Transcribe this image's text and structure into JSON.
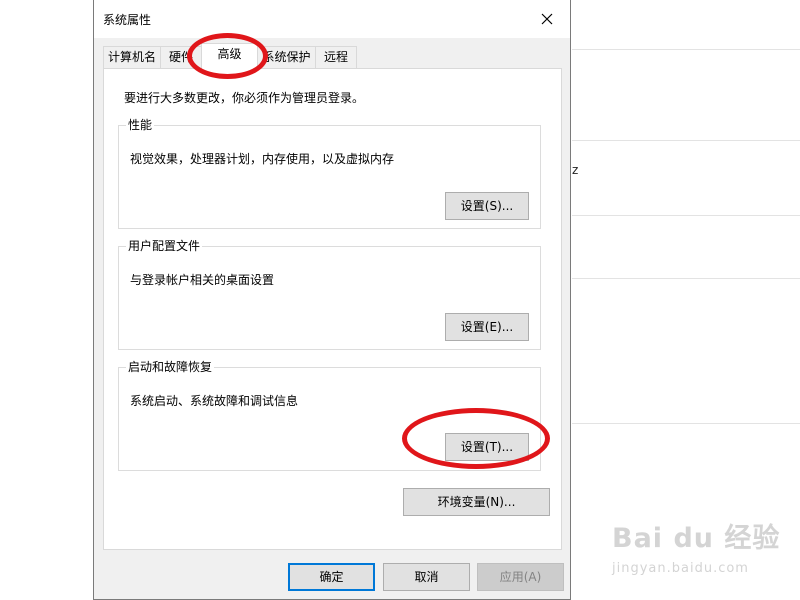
{
  "background": {
    "frag1": "z"
  },
  "dialog": {
    "title": "系统属性",
    "tabs": [
      {
        "label": "计算机名"
      },
      {
        "label": "硬件"
      },
      {
        "label": "高级"
      },
      {
        "label": "系统保护"
      },
      {
        "label": "远程"
      }
    ],
    "active_tab": "高级",
    "notice": "要进行大多数更改，你必须作为管理员登录。",
    "groups": {
      "performance": {
        "legend": "性能",
        "desc": "视觉效果，处理器计划，内存使用，以及虚拟内存",
        "button": "设置(S)..."
      },
      "profiles": {
        "legend": "用户配置文件",
        "desc": "与登录帐户相关的桌面设置",
        "button": "设置(E)..."
      },
      "startup": {
        "legend": "启动和故障恢复",
        "desc": "系统启动、系统故障和调试信息",
        "button": "设置(T)..."
      }
    },
    "env_button": "环境变量(N)...",
    "footer": {
      "ok": "确定",
      "cancel": "取消",
      "apply": "应用(A)"
    }
  },
  "watermark": {
    "logo": "Bai du 经验",
    "url": "jingyan.baidu.com"
  },
  "colors": {
    "annotation": "#e0161a",
    "primary_border": "#0078d7",
    "dialog_bg": "#f0f0f0"
  }
}
